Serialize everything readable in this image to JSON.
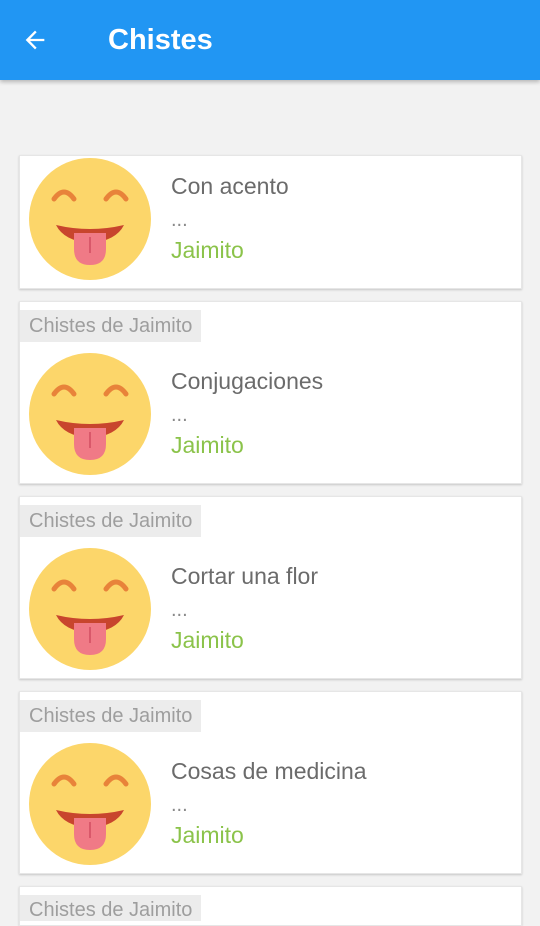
{
  "app_bar": {
    "title": "Chistes",
    "back_icon": "arrow-back-icon"
  },
  "jokes": [
    {
      "title": "Con acento",
      "snippet": "...",
      "author": "Jaimito",
      "avatar_icon": "tongue-out-emoji-icon"
    },
    {
      "category": "Chistes de Jaimito",
      "title": "Conjugaciones",
      "snippet": "...",
      "author": "Jaimito",
      "avatar_icon": "tongue-out-emoji-icon"
    },
    {
      "category": "Chistes de Jaimito",
      "title": "Cortar una flor",
      "snippet": "...",
      "author": "Jaimito",
      "avatar_icon": "tongue-out-emoji-icon"
    },
    {
      "category": "Chistes de Jaimito",
      "title": "Cosas de medicina",
      "snippet": "...",
      "author": "Jaimito",
      "avatar_icon": "tongue-out-emoji-icon"
    },
    {
      "category": "Chistes de Jaimito"
    }
  ],
  "colors": {
    "app_bar": "#2196f3",
    "author": "#8bc34a",
    "emoji_face": "#fcd66a",
    "emoji_tongue": "#f07a86"
  }
}
